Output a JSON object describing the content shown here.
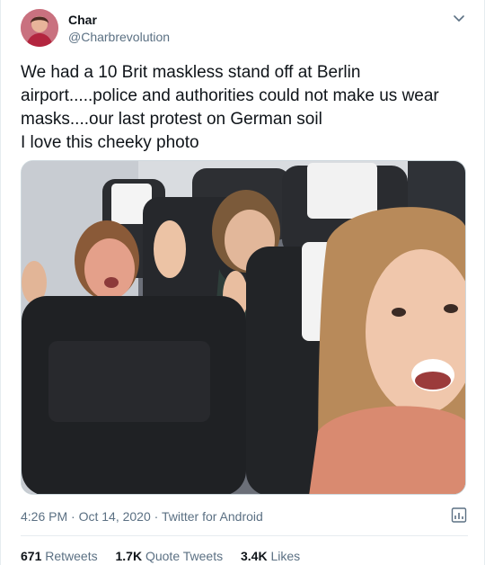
{
  "author": {
    "name": "Char",
    "handle": "@Charbrevolution"
  },
  "tweet": {
    "lines": [
      "We had a 10 Brit maskless stand off at Berlin",
      "airport.....police and authorities could not make us wear",
      "masks....our last protest on German soil",
      "I love this cheeky photo"
    ]
  },
  "meta": {
    "time": "4:26 PM",
    "separator": "·",
    "date": "Oct 14, 2020",
    "source": "Twitter for Android"
  },
  "stats": {
    "retweets_count": "671",
    "retweets_label": "Retweets",
    "quotes_count": "1.7K",
    "quotes_label": "Quote Tweets",
    "likes_count": "3.4K",
    "likes_label": "Likes"
  },
  "colors": {
    "text": "#0f1419",
    "secondary": "#5b7083",
    "border": "#e6ecf0"
  },
  "icons": [
    "chevron-down-icon",
    "analytics-icon"
  ]
}
